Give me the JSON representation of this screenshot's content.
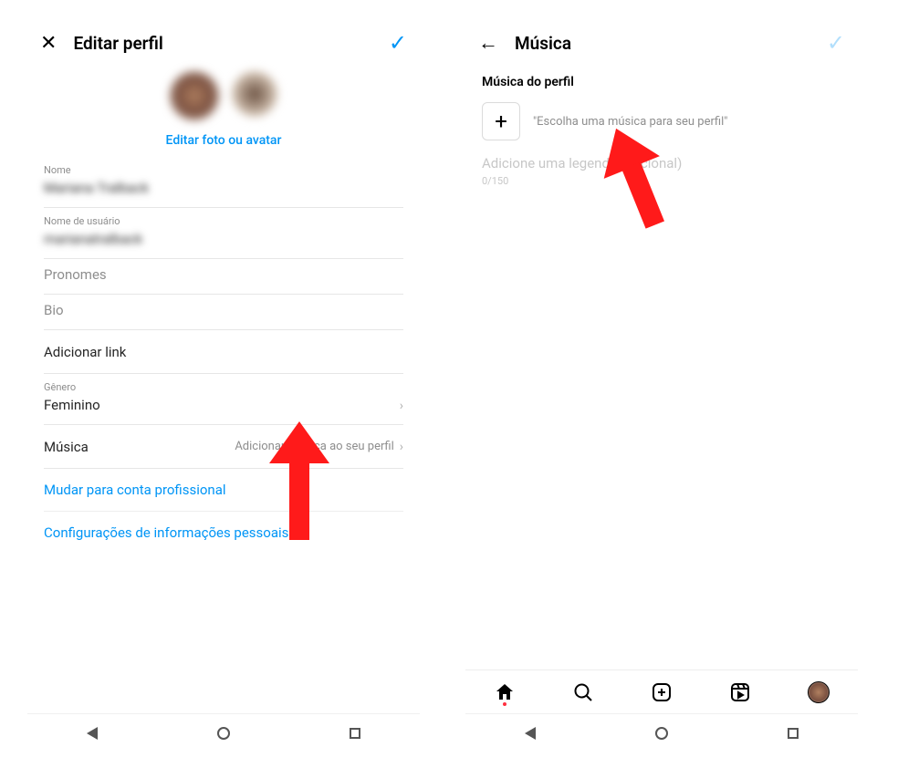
{
  "left": {
    "title": "Editar perfil",
    "edit_link": "Editar foto ou avatar",
    "fields": {
      "nome_label": "Nome",
      "nome_value": "Mariana Tralback",
      "user_label": "Nome de usuário",
      "user_value": "marianatralback",
      "pronomes_label": "Pronomes",
      "bio_label": "Bio",
      "addlink_label": "Adicionar link",
      "genero_label": "Gênero",
      "genero_value": "Feminino",
      "musica_label": "Música",
      "musica_value": "Adicionar música ao seu perfil"
    },
    "links": {
      "prof": "Mudar para conta profissional",
      "personal": "Configurações de informações pessoais"
    }
  },
  "right": {
    "title": "Música",
    "section": "Música do perfil",
    "add_text": "\"Escolha uma música para seu perfil\"",
    "caption_placeholder": "Adicione uma legenda (opcional)",
    "limit": "0/150"
  }
}
